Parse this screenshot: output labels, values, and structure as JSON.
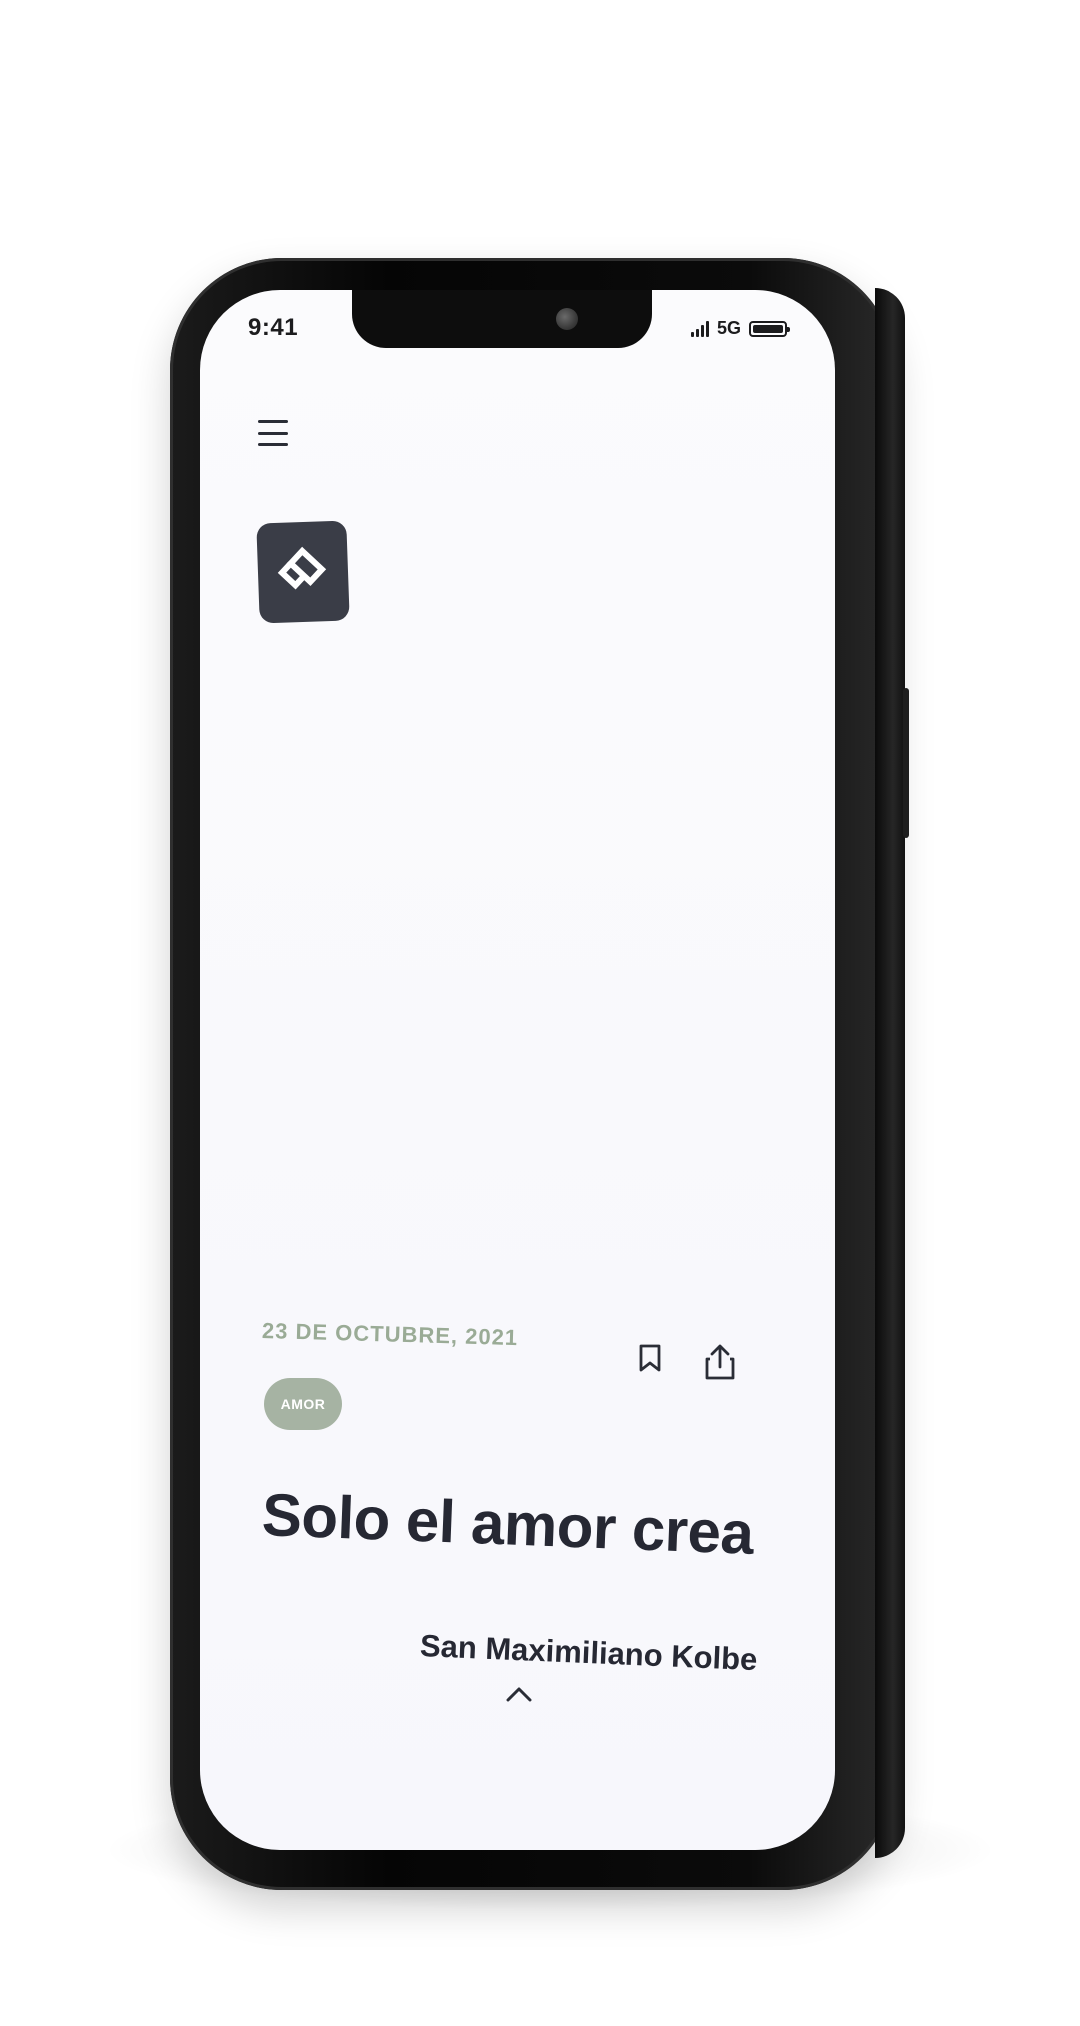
{
  "status_bar": {
    "time": "9:41",
    "network": "5G"
  },
  "header": {
    "menu_icon": "hamburger-menu-icon",
    "logo_icon": "app-logo-icon"
  },
  "article": {
    "date": "23 DE OCTUBRE, 2021",
    "tag": "AMOR",
    "title": "Solo el amor crea",
    "author": "San Maximiliano Kolbe",
    "actions": {
      "bookmark_icon": "bookmark-icon",
      "share_icon": "share-icon",
      "expand_icon": "chevron-up-icon"
    }
  },
  "colors": {
    "accent_green": "#9aab96",
    "tag_background": "#a6b3a3",
    "text_dark": "#262833",
    "logo_background": "#3a3d47",
    "screen_background": "#f9f9fd"
  }
}
